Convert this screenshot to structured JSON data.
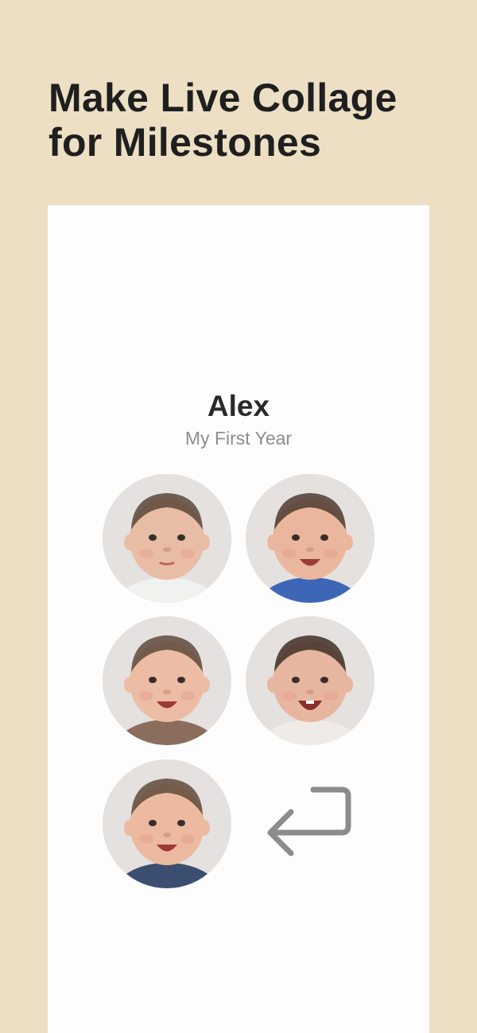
{
  "headline": {
    "line1": "Make Live Collage",
    "line2": "for Milestones"
  },
  "collage": {
    "name": "Alex",
    "subtitle": "My First Year"
  },
  "photos": [
    {
      "label": "baby-photo-newborn",
      "shirt": "#f1f1ef",
      "skin": "#e9bda5",
      "hair": "#5a4638",
      "mouth": "neutral"
    },
    {
      "label": "baby-photo-smiling",
      "shirt": "#3d67b6",
      "skin": "#eab79e",
      "hair": "#4d3b31",
      "mouth": "smile"
    },
    {
      "label": "baby-photo-plaid-shirt",
      "shirt": "#8a6d5d",
      "skin": "#ecbda4",
      "hair": "#5e4a3c",
      "mouth": "smile"
    },
    {
      "label": "baby-photo-laughing",
      "shirt": "#f0ebe6",
      "skin": "#e7b6a0",
      "hair": "#3f2f27",
      "mouth": "laugh"
    },
    {
      "label": "baby-photo-denim-shirt",
      "shirt": "#3b4e6f",
      "skin": "#ecbaa1",
      "hair": "#604a3b",
      "mouth": "smile"
    }
  ],
  "icons": {
    "back": "return-arrow-icon"
  },
  "colors": {
    "background": "#ecdfc4",
    "card": "#fdfdfd",
    "headline": "#1f1f1f",
    "name": "#2a2a2a",
    "subtitle": "#8e8e8e",
    "icon": "#8c8c8c"
  }
}
